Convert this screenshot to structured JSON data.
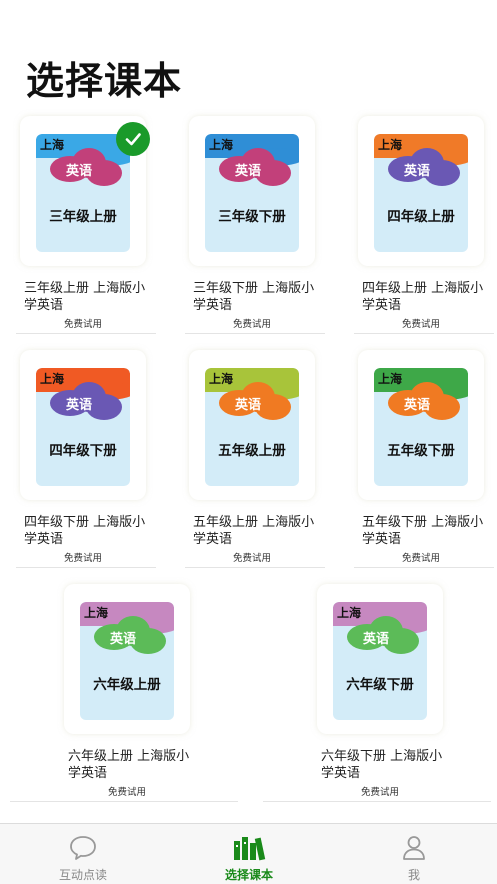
{
  "page": {
    "title": "选择课本"
  },
  "books": [
    {
      "region": "上海",
      "subject": "英语",
      "grade": "三年级上册",
      "title": "三年级上册 上海版小学英语",
      "trial": "免费试用",
      "top_color": "#3aa8e6",
      "cloud_color": "#c2407a",
      "selected": true
    },
    {
      "region": "上海",
      "subject": "英语",
      "grade": "三年级下册",
      "title": "三年级下册 上海版小学英语",
      "trial": "免费试用",
      "top_color": "#2f8ed6",
      "cloud_color": "#c2407a",
      "selected": false
    },
    {
      "region": "上海",
      "subject": "英语",
      "grade": "四年级上册",
      "title": "四年级上册 上海版小学英语",
      "trial": "免费试用",
      "top_color": "#f07a28",
      "cloud_color": "#6a58b4",
      "selected": false
    },
    {
      "region": "上海",
      "subject": "英语",
      "grade": "四年级下册",
      "title": "四年级下册 上海版小学英语",
      "trial": "免费试用",
      "top_color": "#f05a24",
      "cloud_color": "#6a58b4",
      "selected": false
    },
    {
      "region": "上海",
      "subject": "英语",
      "grade": "五年级上册",
      "title": "五年级上册 上海版小学英语",
      "trial": "免费试用",
      "top_color": "#a8c43a",
      "cloud_color": "#f07a22",
      "selected": false
    },
    {
      "region": "上海",
      "subject": "英语",
      "grade": "五年级下册",
      "title": "五年级下册 上海版小学英语",
      "trial": "免费试用",
      "top_color": "#3ea848",
      "cloud_color": "#f07a22",
      "selected": false
    },
    {
      "region": "上海",
      "subject": "英语",
      "grade": "六年级上册",
      "title": "六年级上册 上海版小学英语",
      "trial": "免费试用",
      "top_color": "#c688c0",
      "cloud_color": "#5cbb58",
      "selected": false
    },
    {
      "region": "上海",
      "subject": "英语",
      "grade": "六年级下册",
      "title": "六年级下册 上海版小学英语",
      "trial": "免费试用",
      "top_color": "#c688c0",
      "cloud_color": "#5cbb58",
      "selected": false
    }
  ],
  "tabbar": {
    "tabs": [
      {
        "label": "互动点读",
        "icon": "chat-bubble-icon",
        "active": false
      },
      {
        "label": "选择课本",
        "icon": "books-icon",
        "active": true
      },
      {
        "label": "我",
        "icon": "person-icon",
        "active": false
      }
    ],
    "active_color": "#1a8a1a"
  },
  "colors": {
    "check": "#1a9a2a",
    "cover_bg": "#d3ecf8"
  }
}
